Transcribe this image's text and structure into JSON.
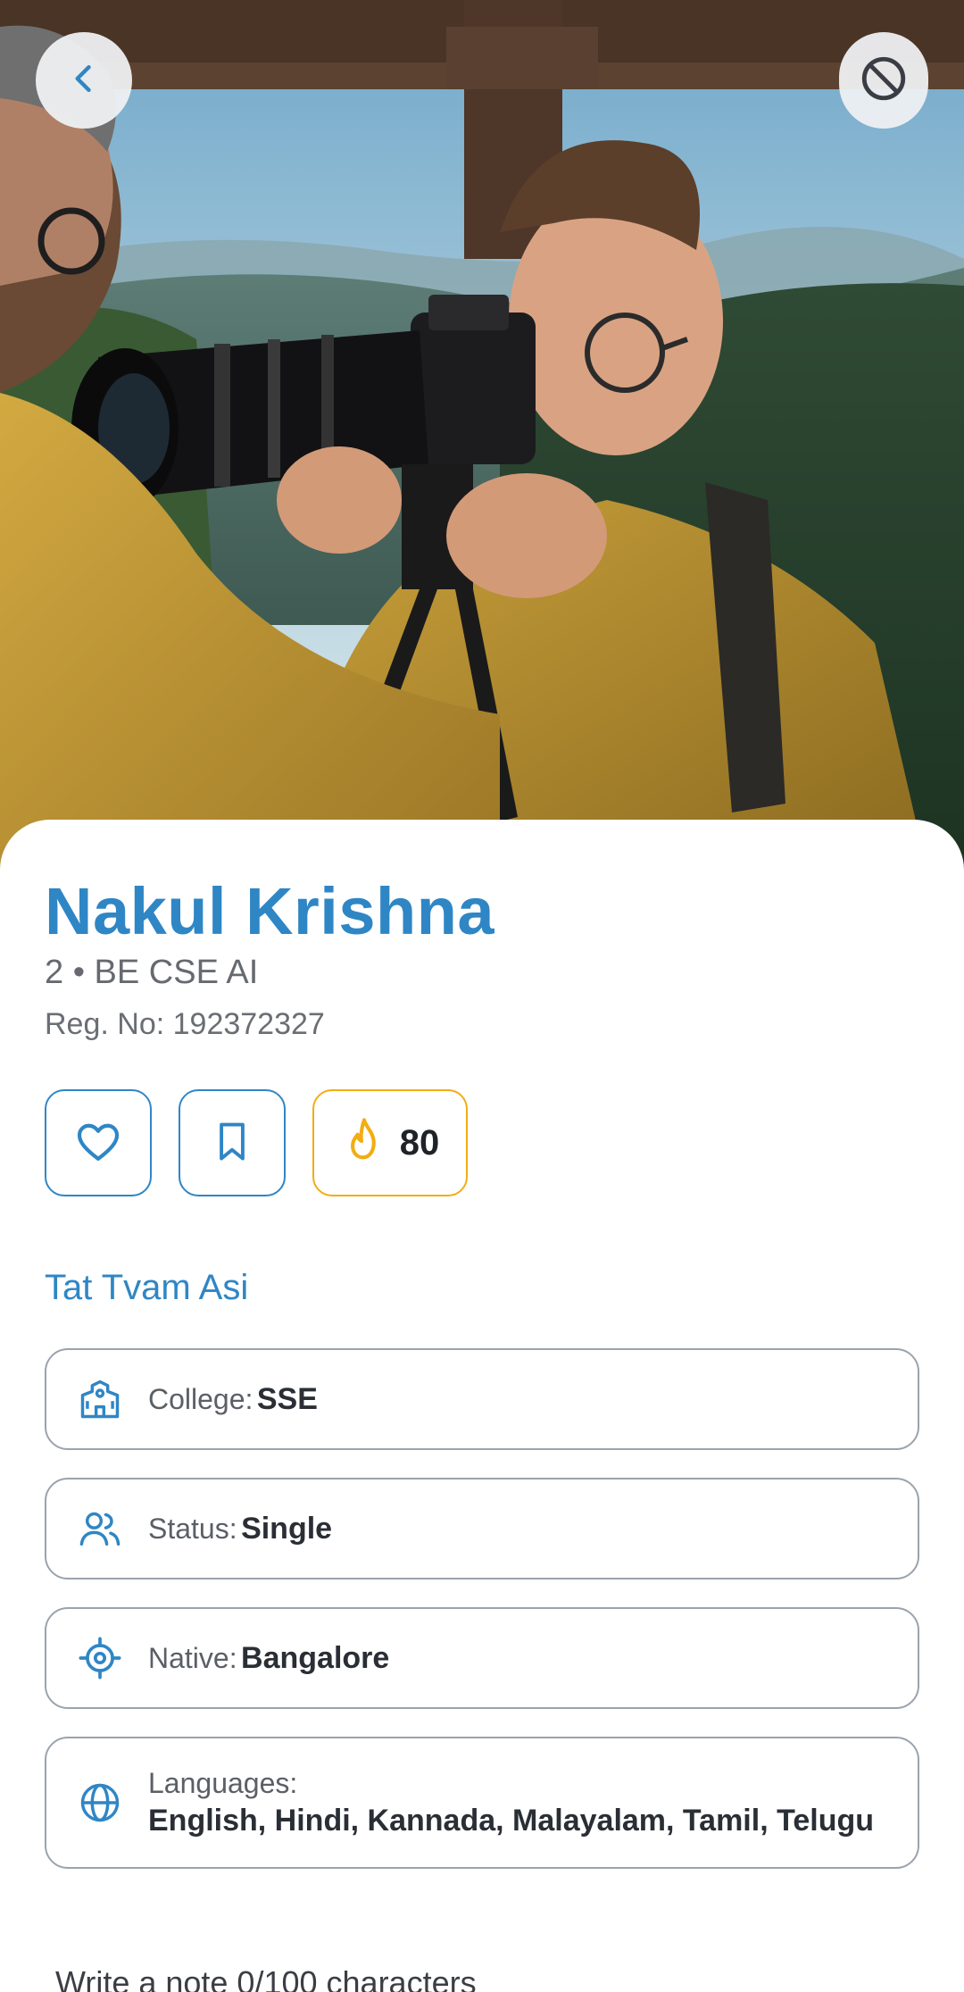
{
  "profile": {
    "name": "Nakul Krishna",
    "subtitle": "2 • BE CSE AI",
    "reg_no": "Reg. No: 192372327",
    "tagline": "Tat Tvam Asi"
  },
  "actions": {
    "streak_count": "80",
    "icons": [
      "heart-icon",
      "bookmark-icon",
      "flame-icon"
    ]
  },
  "info": {
    "college": {
      "label": "College:",
      "value": "SSE",
      "icon": "school-building-icon"
    },
    "status": {
      "label": "Status:",
      "value": "Single",
      "icon": "users-icon"
    },
    "native": {
      "label": "Native:",
      "value": "Bangalore",
      "icon": "location-target-icon"
    },
    "languages": {
      "label": "Languages:",
      "value": "English, Hindi, Kannada, Malayalam, Tamil, Telugu",
      "icon": "globe-icon"
    }
  },
  "note": {
    "prompt": "Write a note 0/100 characters"
  },
  "colors": {
    "accent": "#2f86c5",
    "streak": "#f2ad14",
    "text_dark": "#2a2e35",
    "card_border": "#9aa3ad"
  }
}
